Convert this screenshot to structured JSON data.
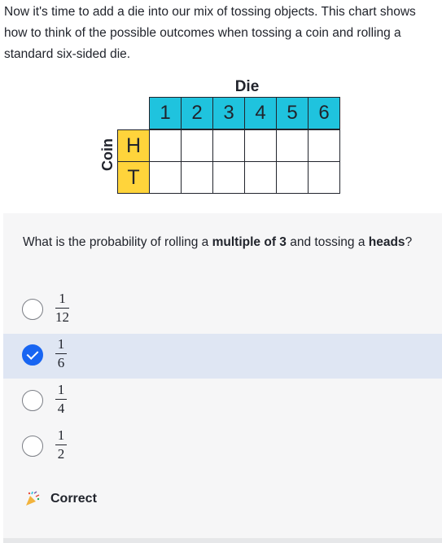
{
  "intro": "Now it's time to add a die into our mix of tossing objects. This chart shows how to think of the possible outcomes when tossing a coin and rolling a standard six-sided die.",
  "chart": {
    "die_label": "Die",
    "die_faces": [
      "1",
      "2",
      "3",
      "4",
      "5",
      "6"
    ],
    "coin_label": "Coin",
    "coin_faces": [
      "H",
      "T"
    ]
  },
  "question": {
    "prefix": "What is the probability of rolling a ",
    "bold1": "multiple of 3",
    "middle": " and tossing a ",
    "bold2": "heads",
    "suffix": "?"
  },
  "choices": [
    {
      "num": "1",
      "den": "12",
      "selected": false
    },
    {
      "num": "1",
      "den": "6",
      "selected": true
    },
    {
      "num": "1",
      "den": "4",
      "selected": false
    },
    {
      "num": "1",
      "den": "2",
      "selected": false
    }
  ],
  "feedback": {
    "label": "Correct",
    "icon": "party-popper-icon"
  },
  "colors": {
    "die_header": "#1fc3de",
    "coin_header": "#ffd43b",
    "selected_bg": "#dfe6f3",
    "radio_checked": "#1865f2"
  }
}
